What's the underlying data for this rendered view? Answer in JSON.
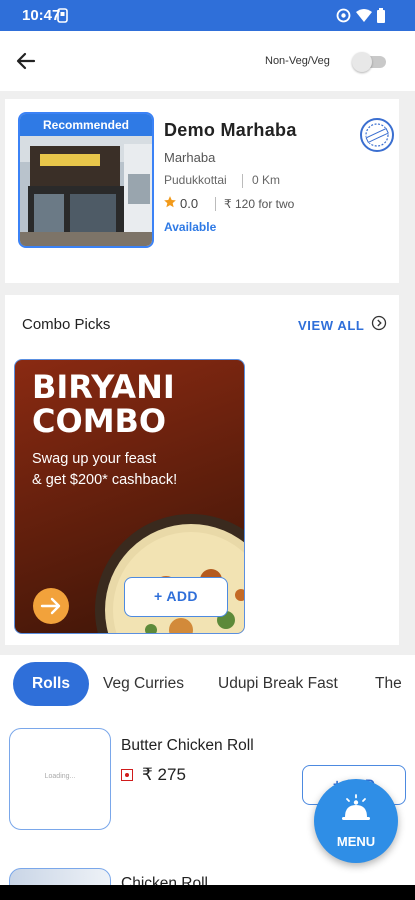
{
  "status_bar": {
    "time": "10:47"
  },
  "header": {
    "veg_toggle_label": "Non-Veg/Veg",
    "veg_toggle_on": false
  },
  "restaurant": {
    "badge": "Recommended",
    "name": "Demo Marhaba",
    "subtitle": "Marhaba",
    "location": "Pudukkottai",
    "distance": "0 Km",
    "rating": "0.0",
    "price": "₹ 120 for two",
    "availability": "Available"
  },
  "combo": {
    "title": "Combo Picks",
    "view_all": "VIEW ALL",
    "promo": {
      "headline_1": "BIRYANI",
      "headline_2": "COMBO",
      "text_1": "Swag up your feast",
      "text_2": "& get $200* cashback!",
      "add_label": "+ ADD"
    }
  },
  "tabs": [
    {
      "label": "Rolls",
      "active": true
    },
    {
      "label": "Veg Curries",
      "active": false
    },
    {
      "label": "Udupi Break Fast",
      "active": false
    },
    {
      "label": "The",
      "active": false
    }
  ],
  "items": [
    {
      "name": "Butter Chicken Roll",
      "price": "₹ 275",
      "thumb_text": "Loading...",
      "add_label": "+ ADD"
    },
    {
      "name": "Chicken Roll"
    }
  ],
  "fab": {
    "label": "MENU"
  },
  "colors": {
    "primary": "#2f6fd9",
    "accent_orange": "#f2a23b",
    "nonveg_red": "#d01c1c"
  }
}
